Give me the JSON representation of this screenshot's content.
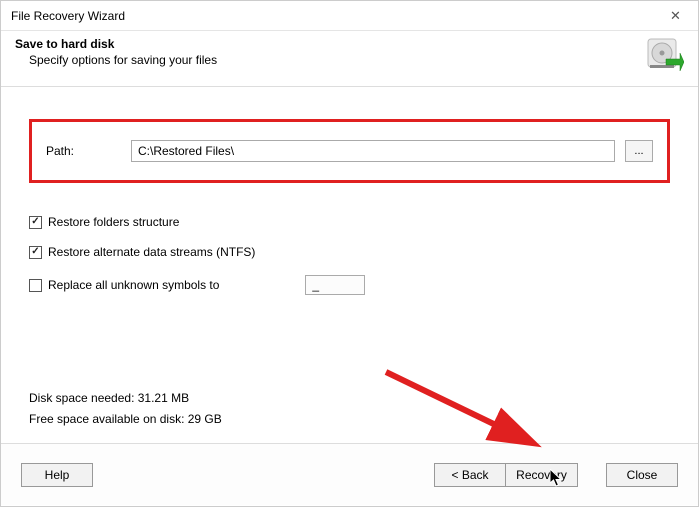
{
  "window": {
    "title": "File Recovery Wizard",
    "close_glyph": "✕"
  },
  "header": {
    "title": "Save to hard disk",
    "subtitle": "Specify options for saving your files"
  },
  "path": {
    "label": "Path:",
    "value": "C:\\Restored Files\\",
    "browse_label": "..."
  },
  "options": {
    "restore_folders": {
      "label": "Restore folders structure",
      "checked": true
    },
    "restore_ads": {
      "label": "Restore alternate data streams (NTFS)",
      "checked": true
    },
    "replace_symbols": {
      "label": "Replace all unknown symbols to",
      "checked": false,
      "value": "_"
    }
  },
  "disk": {
    "needed": "Disk space needed: 31.21 MB",
    "free": "Free space available on disk: 29 GB"
  },
  "buttons": {
    "help": "Help",
    "back": "< Back",
    "recovery": "Recovery",
    "close": "Close"
  }
}
